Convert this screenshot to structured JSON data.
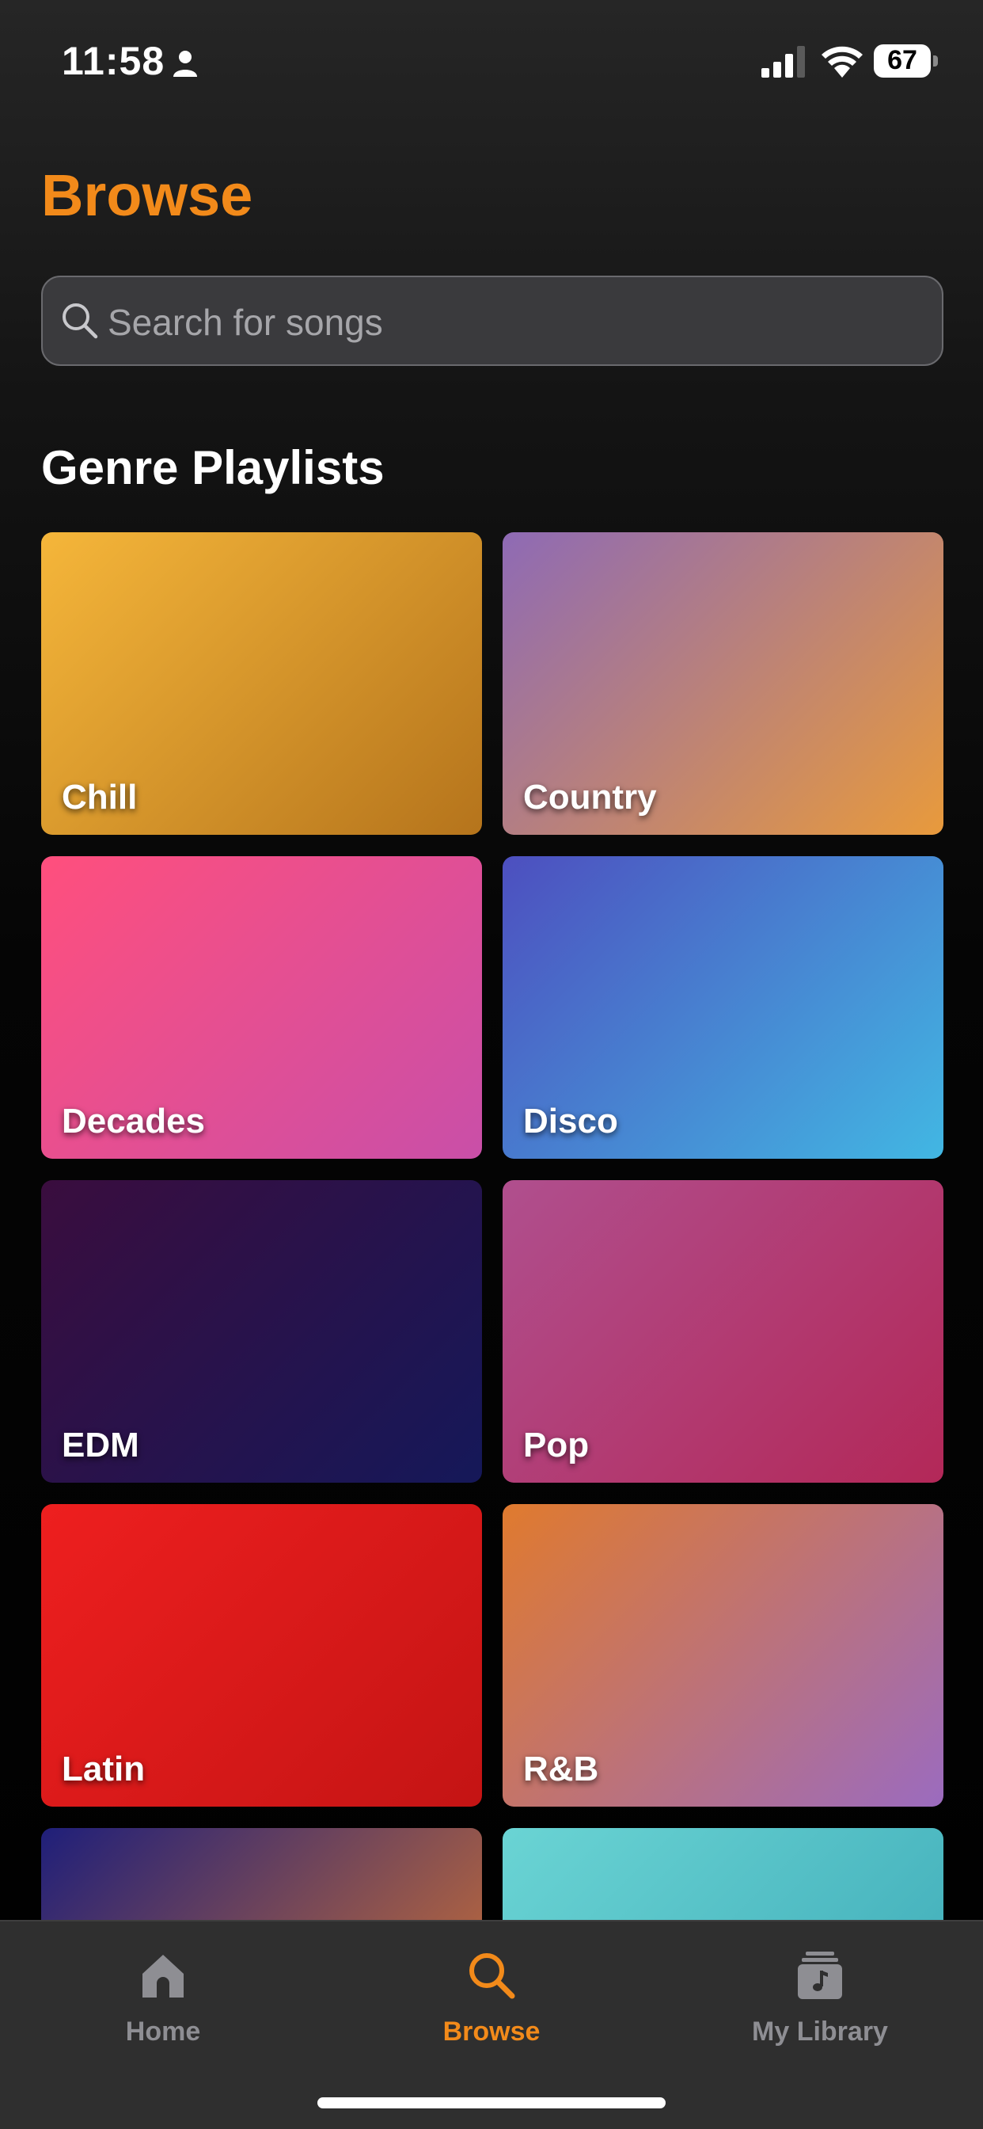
{
  "status_bar": {
    "time": "11:58",
    "battery": "67",
    "icons": [
      "person-icon",
      "signal-icon",
      "wifi-icon",
      "battery-icon"
    ]
  },
  "header": {
    "title": "Browse"
  },
  "search": {
    "placeholder": "Search for songs",
    "icon": "search-icon"
  },
  "section": {
    "title": "Genre Playlists"
  },
  "genres": [
    {
      "label": "Chill",
      "colors": [
        "#f5b63a",
        "#b5741c"
      ]
    },
    {
      "label": "Country",
      "colors": [
        "#8e6ab5",
        "#e89a3c"
      ]
    },
    {
      "label": "Decades",
      "colors": [
        "#ff4f7d",
        "#c94fa8"
      ]
    },
    {
      "label": "Disco",
      "colors": [
        "#4d4fbf",
        "#42b7e3"
      ]
    },
    {
      "label": "EDM",
      "colors": [
        "#3a0d3e",
        "#151859"
      ]
    },
    {
      "label": "Pop",
      "colors": [
        "#b04f8e",
        "#b32858"
      ]
    },
    {
      "label": "Latin",
      "colors": [
        "#ee1f1f",
        "#c41414"
      ]
    },
    {
      "label": "R&B",
      "colors": [
        "#e07a2e",
        "#9b6bbf"
      ]
    },
    {
      "label": "",
      "colors": [
        "#1f1f7a",
        "#e07a2e"
      ]
    },
    {
      "label": "",
      "colors": [
        "#6ad4d4",
        "#3aa7b5"
      ]
    }
  ],
  "tab_bar": {
    "items": [
      {
        "label": "Home",
        "icon": "home-icon",
        "active": false
      },
      {
        "label": "Browse",
        "icon": "search-icon",
        "active": true
      },
      {
        "label": "My Library",
        "icon": "library-icon",
        "active": false
      }
    ],
    "active_color": "#f28a1a",
    "inactive_color": "#8e8e93"
  }
}
